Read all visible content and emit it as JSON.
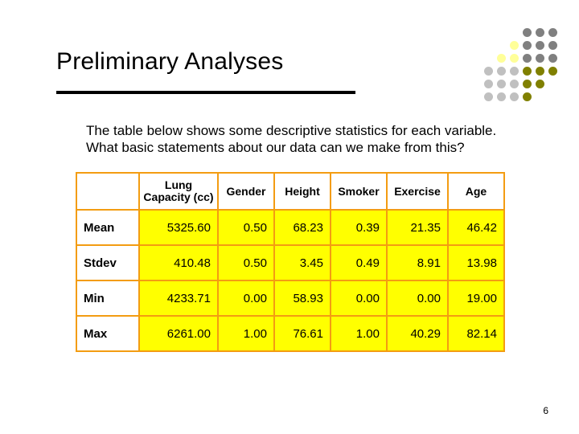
{
  "title": "Preliminary Analyses",
  "intro_line1": "The table below shows some descriptive statistics for each variable.",
  "intro_line2": "What basic statements about our data can we make from this?",
  "page_number": "6",
  "chart_data": {
    "type": "table",
    "title": "Preliminary Analyses",
    "columns": [
      "Lung Capacity (cc)",
      "Gender",
      "Height",
      "Smoker",
      "Exercise",
      "Age"
    ],
    "rows": [
      {
        "label": "Mean",
        "values": [
          "5325.60",
          "0.50",
          "68.23",
          "0.39",
          "21.35",
          "46.42"
        ]
      },
      {
        "label": "Stdev",
        "values": [
          "410.48",
          "0.50",
          "3.45",
          "0.49",
          "8.91",
          "13.98"
        ]
      },
      {
        "label": "Min",
        "values": [
          "4233.71",
          "0.00",
          "58.93",
          "0.00",
          "0.00",
          "19.00"
        ]
      },
      {
        "label": "Max",
        "values": [
          "6261.00",
          "1.00",
          "76.61",
          "1.00",
          "40.29",
          "82.14"
        ]
      }
    ]
  },
  "headers": {
    "lung_l1": "Lung",
    "lung_l2": "Capacity (cc)",
    "gender": "Gender",
    "height": "Height",
    "smoker": "Smoker",
    "exercise": "Exercise",
    "age": "Age"
  },
  "rows": {
    "r0_label": "Mean",
    "r1_label": "Stdev",
    "r2_label": "Min",
    "r3_label": "Max"
  },
  "cells": {
    "r0c0": "5325.60",
    "r0c1": "0.50",
    "r0c2": "68.23",
    "r0c3": "0.39",
    "r0c4": "21.35",
    "r0c5": "46.42",
    "r1c0": "410.48",
    "r1c1": "0.50",
    "r1c2": "3.45",
    "r1c3": "0.49",
    "r1c4": "8.91",
    "r1c5": "13.98",
    "r2c0": "4233.71",
    "r2c1": "0.00",
    "r2c2": "58.93",
    "r2c3": "0.00",
    "r2c4": "0.00",
    "r2c5": "19.00",
    "r3c0": "6261.00",
    "r3c1": "1.00",
    "r3c2": "76.61",
    "r3c3": "1.00",
    "r3c4": "40.29",
    "r3c5": "82.14"
  }
}
